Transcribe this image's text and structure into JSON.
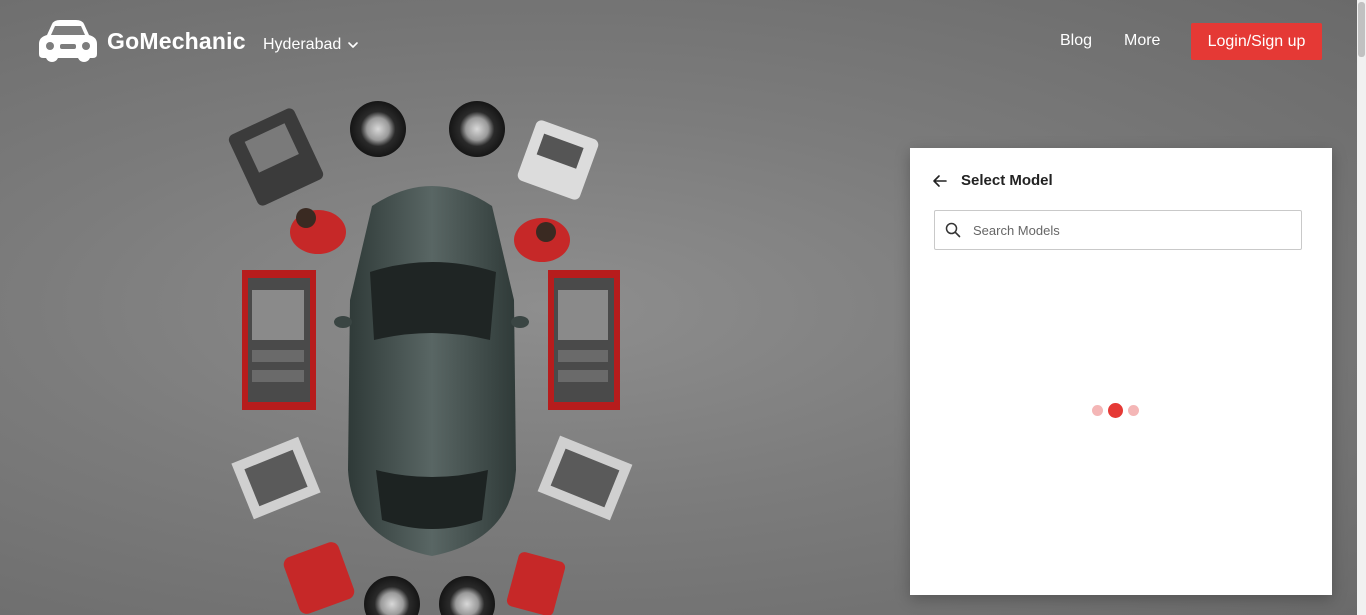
{
  "header": {
    "brand": "GoMechanic",
    "city": "Hyderabad",
    "nav": {
      "blog": "Blog",
      "more": "More"
    },
    "login_label": "Login/Sign up"
  },
  "panel": {
    "title": "Select Model",
    "search_placeholder": "Search Models"
  },
  "icons": {
    "logo": "car-logo-icon",
    "city_dropdown": "chevron-down-icon",
    "back": "arrow-left-icon",
    "search": "search-icon"
  },
  "colors": {
    "accent": "#e53935",
    "loader_light": "#f4b6b6",
    "panel_bg": "#ffffff",
    "background": "#7c7c7c"
  }
}
